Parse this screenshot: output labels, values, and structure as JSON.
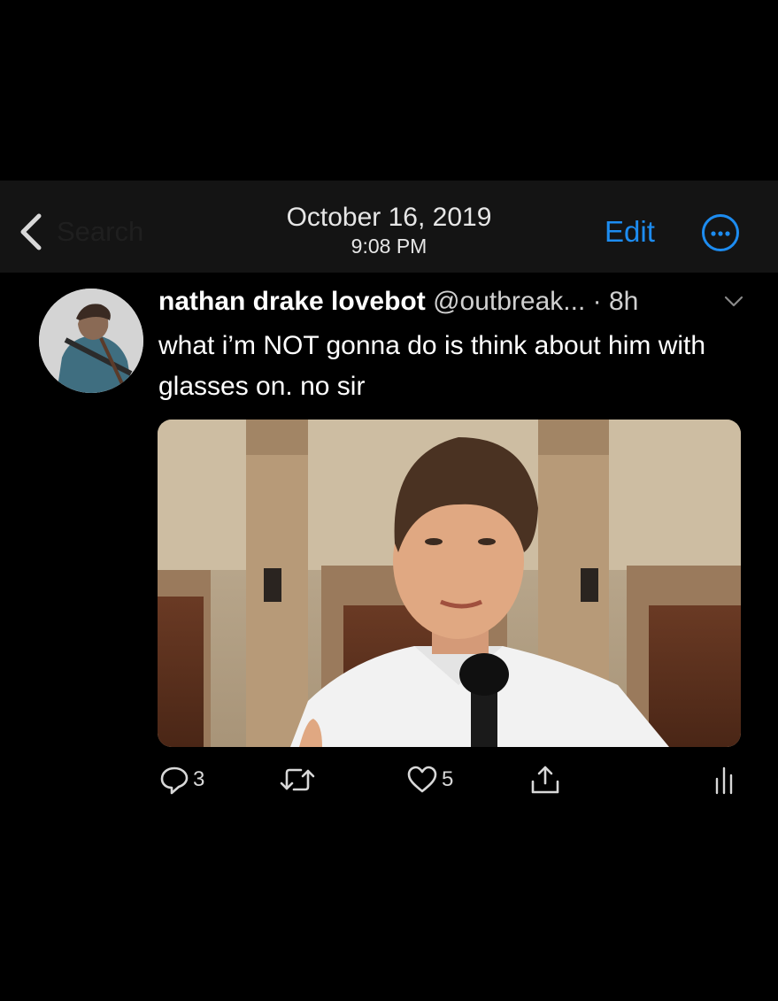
{
  "header": {
    "back_label": "Search",
    "date": "October 16, 2019",
    "time": "9:08 PM",
    "edit_label": "Edit"
  },
  "tweet": {
    "display_name": "nathan drake lovebot",
    "handle": "@outbreak...",
    "age": "· 8h",
    "text": "what i’m NOT gonna do is think about him with glasses on. no sir",
    "replies": "3",
    "likes": "5"
  },
  "icons": {
    "back": "chevron-left-icon",
    "more": "more-circle-icon",
    "caret": "chevron-down-icon",
    "reply": "reply-icon",
    "retweet": "retweet-icon",
    "like": "heart-icon",
    "share": "share-icon",
    "analytics": "analytics-icon"
  },
  "colors": {
    "accent": "#1d8cf0",
    "background": "#000000",
    "header": "#141414"
  }
}
